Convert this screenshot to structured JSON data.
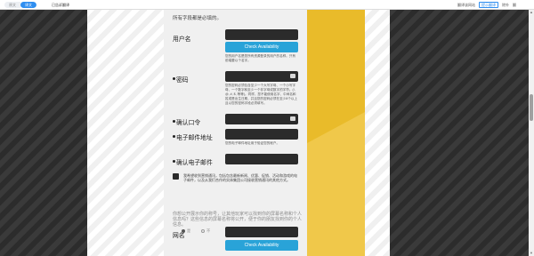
{
  "toolbar": {
    "seg_left": "原文",
    "seg_right": "译文",
    "nav_link": "已告诉翻译",
    "right_1": "翻译该网站",
    "right_2": "提示翻译",
    "right_3": "除外",
    "right_4": "翻"
  },
  "form": {
    "intro": "所有字段都是必填的。",
    "username": {
      "label": "用户名",
      "button": "Check Availability",
      "help": "您的用户名是您所有资源登录的用户的名称。只有前端要以个名字。"
    },
    "password": {
      "label": "密码",
      "help": "您的密码必须包含至少一个大写字母、一个小写字母、一个数字和至少一个非字母或数字的字符。(!, @, #, $, 等等)。同样，您不能使用名字、中间名和姓或是出生日期，并且您的密码必须在至少8个以上且以您的密码字段必须填写。"
    },
    "confirm_password": {
      "label": "确认口令"
    },
    "email": {
      "label": "电子邮件地址",
      "help": "您的电子邮件地址用于验证您的帐户。"
    },
    "confirm_email": {
      "label": "确认电子邮件"
    },
    "consent": "我希望收到营销通讯，包括包含最新新闻、优惠、促销、活动和游戏的电子邮件，以及从我们合作的实体集团公司接收营销通讯的其他方式。",
    "question": "你想公开展示你的称号，让其他玩家可以找到你的屏幕名称和个人信息吗？这些信息的屏幕名称将公开，便于你的朋友找到你的个人信息。",
    "radio_yes": "是",
    "radio_no": "不",
    "netname": {
      "label": "网名",
      "button": "Check Availability"
    }
  },
  "colors": {
    "accent_blue": "#29a3d8",
    "input_dark": "#2b2b2b",
    "yellow": "#e9bb2a"
  }
}
